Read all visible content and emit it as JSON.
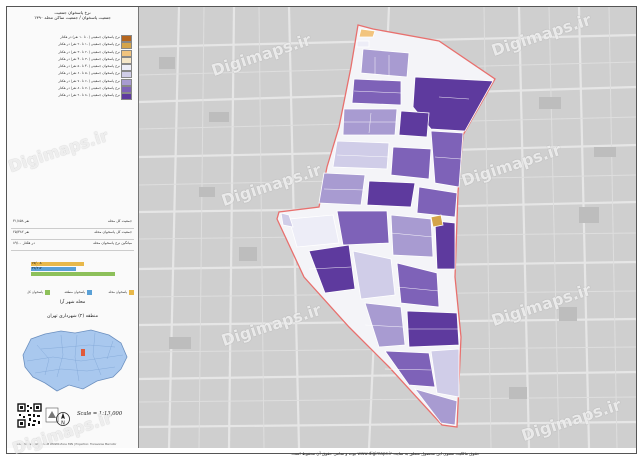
{
  "title": {
    "line1": "نرخ پاسخوان جمعیت",
    "line2": "جمعیت پاسخوان / جمعیت ساکن محله ۱۳۹۰"
  },
  "legend": [
    {
      "label": "نرخ پاسخوان جمعیتی (۰ تا ۱۰ نفر) در هکتار",
      "color": "#b5651d"
    },
    {
      "label": "نرخ پاسخوان جمعیتی (۱۰ تا ۲۰ نفر) در هکتار",
      "color": "#d4a44a"
    },
    {
      "label": "نرخ پاسخوان جمعیتی (۲۰ تا ۳۰ نفر) در هکتار",
      "color": "#f2c47e"
    },
    {
      "label": "نرخ پاسخوان جمعیتی (۳۰ تا ۴۰ نفر) در هکتار",
      "color": "#f5e6c8"
    },
    {
      "label": "نرخ پاسخوان جمعیتی (۴۰ تا ۵۰ نفر) در هکتار",
      "color": "#ededf7"
    },
    {
      "label": "نرخ پاسخوان جمعیتی (۵۰ تا ۶۰ نفر) در هکتار",
      "color": "#d0cde8"
    },
    {
      "label": "نرخ پاسخوان جمعیتی (۶۰ تا ۷۰ نفر) در هکتار",
      "color": "#a89bd1"
    },
    {
      "label": "نرخ پاسخوان جمعیتی (۷۰ تا ۸۰ نفر) در هکتار",
      "color": "#7e62b8"
    },
    {
      "label": "نرخ پاسخوان جمعیتی (۸۰ تا ۹۰ نفر) در هکتار",
      "color": "#5e3a9e"
    }
  ],
  "stats": [
    {
      "label": "جمعیت کل محله",
      "value": "۳۱/۸۵۸ نفر"
    },
    {
      "label": "جمعیت کل پاسخوان محله",
      "value": "۲۵/۳۸۲ نفر"
    },
    {
      "label": "میانگین نرخ پاسخوان محله",
      "value": "۸۹/۰۰ در هکتار"
    }
  ],
  "bars": [
    {
      "label": "۷۷/۰۰۸",
      "fraction": 0.62,
      "color": "#e8b84a"
    },
    {
      "label": "۳۶/۶۱۷",
      "fraction": 0.52,
      "color": "#5aa0d6"
    },
    {
      "label": "",
      "fraction": 0.98,
      "color": "#8dc05a"
    }
  ],
  "bar_legend": [
    {
      "label": "پاسخوان محله",
      "color": "#e8b84a"
    },
    {
      "label": "پاسخوان منطقه",
      "color": "#5aa0d6"
    },
    {
      "label": "پاسخوان کل",
      "color": "#8dc05a"
    }
  ],
  "neighborhood": "محله شهر آرا",
  "region": "منطقه (۲) شهرداری تهران",
  "scale": "Scale = 1:13,000",
  "north_label": "N",
  "footer": "Coordinate System: UTM WGS84 Zone 39N | Projection: Transverse Mercator",
  "copyright": "حقوق مالکیت معنوی این محصول متعلق به سایت www.digimaps.ir بوده و تمامی حقوق آن محفوظ است.",
  "watermark": "Digimaps.ir",
  "colors": {
    "boundary": "#e8706e",
    "map_bg": "#cfcfcf",
    "road": "#e9e9e9"
  }
}
